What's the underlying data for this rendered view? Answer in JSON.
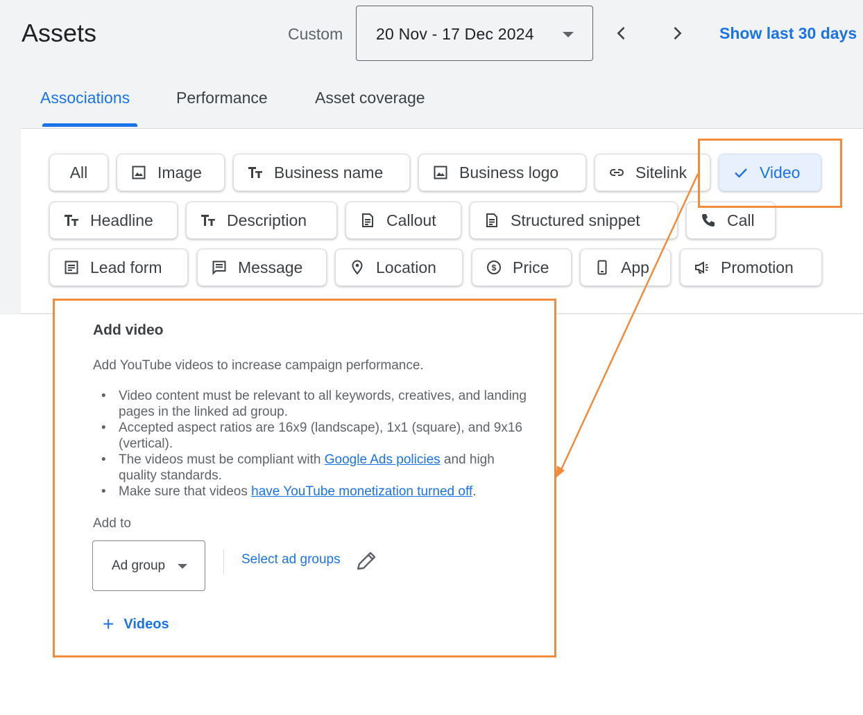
{
  "header": {
    "title": "Assets",
    "date_label": "Custom",
    "date_range": "20 Nov - 17 Dec 2024",
    "show_last": "Show last 30 days"
  },
  "tabs": [
    {
      "label": "Associations",
      "active": true
    },
    {
      "label": "Performance",
      "active": false
    },
    {
      "label": "Asset coverage",
      "active": false
    }
  ],
  "chips": {
    "all": "All",
    "image": "Image",
    "business_name": "Business name",
    "business_logo": "Business logo",
    "sitelink": "Sitelink",
    "video": "Video",
    "headline": "Headline",
    "description": "Description",
    "callout": "Callout",
    "structured_snippet": "Structured snippet",
    "call": "Call",
    "lead_form": "Lead form",
    "message": "Message",
    "location": "Location",
    "price": "Price",
    "app": "App",
    "promotion": "Promotion"
  },
  "selected_chip": "Video",
  "panel": {
    "title": "Add video",
    "description": "Add YouTube videos to increase campaign performance.",
    "bullets": {
      "b1": "Video content must be relevant to all keywords, creatives, and landing pages in the linked ad group.",
      "b2": "Accepted aspect ratios are 16x9 (landscape), 1x1 (square), and 9x16 (vertical).",
      "b3_pre": "The videos must be compliant with ",
      "b3_link": "Google Ads policies",
      "b3_post": " and high quality standards.",
      "b4_pre": "Make sure that videos ",
      "b4_link": "have YouTube monetization turned off",
      "b4_post": "."
    },
    "add_to_label": "Add to",
    "add_to_value": "Ad group",
    "select_groups": "Select ad groups",
    "add_videos": "Videos"
  },
  "colors": {
    "accent": "#1a73e8",
    "highlight": "#f28b3a",
    "background": "#f1f3f4"
  }
}
